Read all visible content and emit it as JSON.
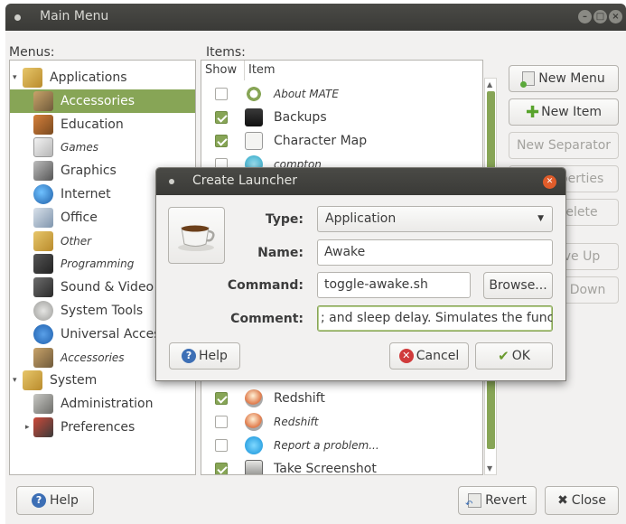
{
  "window": {
    "title": "Main Menu"
  },
  "menus_label": "Menus:",
  "items_label": "Items:",
  "menus": [
    {
      "label": "Applications",
      "icon": "applications-folder-icon",
      "italic": false,
      "selected": false,
      "level": 0,
      "expander": "down"
    },
    {
      "label": "Accessories",
      "icon": "accessories-icon",
      "italic": false,
      "selected": true,
      "level": 1
    },
    {
      "label": "Education",
      "icon": "education-icon",
      "italic": false,
      "selected": false,
      "level": 1
    },
    {
      "label": "Games",
      "icon": "games-icon",
      "italic": true,
      "selected": false,
      "level": 1
    },
    {
      "label": "Graphics",
      "icon": "graphics-icon",
      "italic": false,
      "selected": false,
      "level": 1
    },
    {
      "label": "Internet",
      "icon": "internet-icon",
      "italic": false,
      "selected": false,
      "level": 1
    },
    {
      "label": "Office",
      "icon": "office-icon",
      "italic": false,
      "selected": false,
      "level": 1
    },
    {
      "label": "Other",
      "icon": "other-icon",
      "italic": true,
      "selected": false,
      "level": 1
    },
    {
      "label": "Programming",
      "icon": "programming-icon",
      "italic": true,
      "selected": false,
      "level": 1
    },
    {
      "label": "Sound & Video",
      "icon": "sound-video-icon",
      "italic": false,
      "selected": false,
      "level": 1
    },
    {
      "label": "System Tools",
      "icon": "system-tools-icon",
      "italic": false,
      "selected": false,
      "level": 1
    },
    {
      "label": "Universal Access",
      "icon": "universal-access-icon",
      "italic": false,
      "selected": false,
      "level": 1
    },
    {
      "label": "Accessories",
      "icon": "accessories-icon",
      "italic": true,
      "selected": false,
      "level": 1
    },
    {
      "label": "System",
      "icon": "system-folder-icon",
      "italic": false,
      "selected": false,
      "level": 0,
      "expander": "down"
    },
    {
      "label": "Administration",
      "icon": "administration-icon",
      "italic": false,
      "selected": false,
      "level": 1
    },
    {
      "label": "Preferences",
      "icon": "preferences-icon",
      "italic": false,
      "selected": false,
      "level": 1,
      "expander": "right"
    }
  ],
  "items_columns": {
    "show": "Show",
    "item": "Item"
  },
  "items_top": [
    {
      "label": "About MATE",
      "checked": false,
      "italic": true,
      "icon": "about-mate-icon"
    },
    {
      "label": "Backups",
      "checked": true,
      "italic": false,
      "icon": "backups-icon"
    },
    {
      "label": "Character Map",
      "checked": true,
      "italic": false,
      "icon": "character-map-icon"
    },
    {
      "label": "compton",
      "checked": false,
      "italic": true,
      "icon": "compton-icon"
    }
  ],
  "items_bottom": [
    {
      "label": "Redshift",
      "checked": true,
      "italic": false,
      "icon": "redshift-icon"
    },
    {
      "label": "Redshift",
      "checked": false,
      "italic": true,
      "icon": "redshift-icon"
    },
    {
      "label": "Report a problem...",
      "checked": false,
      "italic": true,
      "icon": "report-problem-icon"
    },
    {
      "label": "Take Screenshot",
      "checked": true,
      "italic": false,
      "icon": "screenshot-icon"
    }
  ],
  "right_buttons": {
    "new_menu": "New Menu",
    "new_item": "New Item",
    "new_separator": "New Separator",
    "properties": "perties",
    "delete": "elete",
    "move_up": "ve Up",
    "move_down": "e Down"
  },
  "bottom_buttons": {
    "help": "Help",
    "revert": "Revert",
    "close": "Close"
  },
  "dialog": {
    "title": "Create Launcher",
    "type_label": "Type:",
    "type_value": "Application",
    "name_label": "Name:",
    "name_value": "Awake",
    "command_label": "Command:",
    "command_value": "toggle-awake.sh",
    "browse": "Browse...",
    "comment_label": "Comment:",
    "comment_value": "; and sleep delay. Simulates the func",
    "help": "Help",
    "cancel": "Cancel",
    "ok": "OK"
  },
  "colors": {
    "accent": "#87a556",
    "titlebar": "#3c3b37",
    "close": "#e05c2a",
    "help_blue": "#3d6fb5",
    "cancel_red": "#d03b3b"
  }
}
